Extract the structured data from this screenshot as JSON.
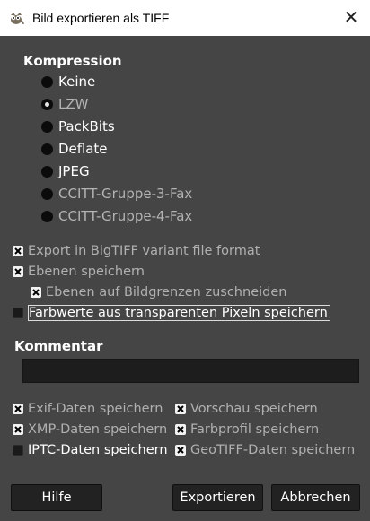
{
  "window": {
    "title": "Bild exportieren als TIFF",
    "close_symbol": "✕",
    "app_icon": "gimp-icon"
  },
  "compression": {
    "title": "Kompression",
    "selected": "LZW",
    "options": [
      {
        "label": "Keine",
        "selected": false,
        "enabled": true
      },
      {
        "label": "LZW",
        "selected": true,
        "enabled": false
      },
      {
        "label": "PackBits",
        "selected": false,
        "enabled": true
      },
      {
        "label": "Deflate",
        "selected": false,
        "enabled": true
      },
      {
        "label": "JPEG",
        "selected": false,
        "enabled": true
      },
      {
        "label": "CCITT-Gruppe-3-Fax",
        "selected": false,
        "enabled": false
      },
      {
        "label": "CCITT-Gruppe-4-Fax",
        "selected": false,
        "enabled": false
      }
    ]
  },
  "options": {
    "bigtiff": {
      "label": "Export in BigTIFF variant file format",
      "checked": true,
      "enabled": false
    },
    "save_layers": {
      "label": "Ebenen speichern",
      "checked": true,
      "enabled": false
    },
    "crop_layers": {
      "label": "Ebenen auf Bildgrenzen zuschneiden",
      "checked": true,
      "enabled": false
    },
    "save_color_values": {
      "label": "Farbwerte aus transparenten Pixeln speichern",
      "checked": false,
      "enabled": true
    }
  },
  "comment": {
    "title": "Kommentar",
    "value": ""
  },
  "metadata": {
    "exif": {
      "label": "Exif-Daten speichern",
      "checked": true,
      "enabled": false
    },
    "preview": {
      "label": "Vorschau speichern",
      "checked": true,
      "enabled": false
    },
    "xmp": {
      "label": "XMP-Daten speichern",
      "checked": true,
      "enabled": false
    },
    "color_profile": {
      "label": "Farbprofil speichern",
      "checked": true,
      "enabled": false
    },
    "iptc": {
      "label": "IPTC-Daten speichern",
      "checked": false,
      "enabled": true
    },
    "geotiff": {
      "label": "GeoTIFF-Daten speichern",
      "checked": true,
      "enabled": false
    }
  },
  "buttons": {
    "help": "Hilfe",
    "export": "Exportieren",
    "cancel": "Abbrechen"
  },
  "colors": {
    "background": "#454545",
    "titlebar": "#ffffff",
    "button": "#222222",
    "field": "#1d1d1d"
  }
}
